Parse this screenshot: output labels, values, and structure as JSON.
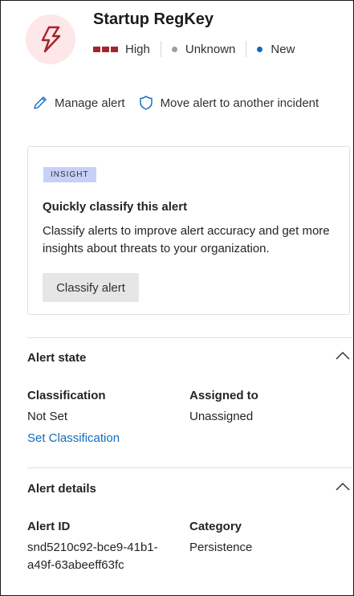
{
  "header": {
    "title": "Startup RegKey",
    "severity": "High",
    "detection_status": "Unknown",
    "status": "New",
    "alert_icon": "lightning-bolt-icon",
    "colors": {
      "severity": "#a4262c",
      "icon_bg": "#fde7e9",
      "status_new": "#0f6cbd",
      "unknown": "#a19f9d"
    }
  },
  "actions": {
    "manage": {
      "label": "Manage alert",
      "icon": "pencil-icon"
    },
    "move": {
      "label": "Move alert to another incident",
      "icon": "shield-icon"
    }
  },
  "insight": {
    "badge": "INSIGHT",
    "title": "Quickly classify this alert",
    "body": "Classify alerts to improve alert accuracy and get more insights about threats to your organization.",
    "button": "Classify alert"
  },
  "alert_state": {
    "title": "Alert state",
    "classification_label": "Classification",
    "classification_value": "Not Set",
    "set_classification_link": "Set Classification",
    "assigned_label": "Assigned to",
    "assigned_value": "Unassigned"
  },
  "alert_details": {
    "title": "Alert details",
    "alert_id_label": "Alert ID",
    "alert_id_line1": "snd5210c92-bce9-41b1-",
    "alert_id_line2": "a49f-63abeeff63fc",
    "category_label": "Category",
    "category_value": "Persistence"
  }
}
